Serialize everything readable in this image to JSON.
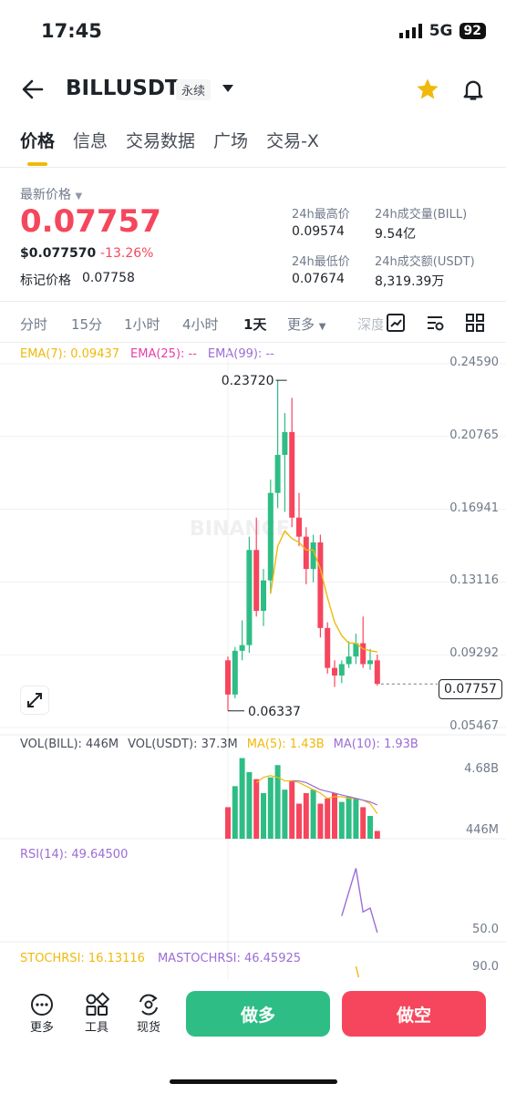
{
  "status": {
    "time": "17:45",
    "network": "5G",
    "battery": "92"
  },
  "header": {
    "pair": "BILLUSDT",
    "perp_badge": "永续"
  },
  "tabs": [
    "价格",
    "信息",
    "交易数据",
    "广场",
    "交易-X"
  ],
  "price": {
    "latest_label": "最新价格",
    "last": "0.07757",
    "usd": "$0.077570",
    "change": "-13.26%",
    "mark_label": "标记价格",
    "mark_value": "0.07758"
  },
  "stats": {
    "high_label": "24h最高价",
    "high": "0.09574",
    "vol_bill_label": "24h成交量(BILL)",
    "vol_bill": "9.54亿",
    "low_label": "24h最低价",
    "low": "0.07674",
    "vol_usdt_label": "24h成交额(USDT)",
    "vol_usdt": "8,319.39万"
  },
  "intervals": [
    "分时",
    "15分",
    "1小时",
    "4小时",
    "1天",
    "更多",
    "深度"
  ],
  "active_interval": "1天",
  "ema": {
    "ema7": "EMA(7): 0.09437",
    "ema25": "EMA(25): --",
    "ema99": "EMA(99): --"
  },
  "volume_legend": {
    "bill": "VOL(BILL): 446M",
    "usdt": "VOL(USDT): 37.3M",
    "ma5": "MA(5): 1.43B",
    "ma10": "MA(10): 1.93B"
  },
  "rsi_legend": "RSI(14): 49.64500",
  "stoch_legend": {
    "stoch": "STOCHRSI: 16.13116",
    "mastoch": "MASTOCHRSI: 46.45925"
  },
  "watermark": "BINANCE",
  "colors": {
    "up": "#2ebd85",
    "down": "#f6465d",
    "accent": "#f0b90b",
    "ema7": "#f0b90b",
    "ma10": "#9c6cd6"
  },
  "chart_data": [
    {
      "type": "candlestick",
      "y_ticks": [
        "0.24590",
        "0.20765",
        "0.16941",
        "0.13116",
        "0.09292",
        "0.05467"
      ],
      "ylim": [
        0.05467,
        0.2459
      ],
      "annotations": {
        "high": "0.23720",
        "low": "0.06337",
        "last": "0.07757"
      },
      "candles": [
        {
          "o": 0.09,
          "h": 0.092,
          "l": 0.0634,
          "c": 0.072
        },
        {
          "o": 0.072,
          "h": 0.097,
          "l": 0.07,
          "c": 0.095
        },
        {
          "o": 0.095,
          "h": 0.111,
          "l": 0.09,
          "c": 0.098
        },
        {
          "o": 0.098,
          "h": 0.155,
          "l": 0.094,
          "c": 0.148
        },
        {
          "o": 0.148,
          "h": 0.165,
          "l": 0.113,
          "c": 0.116
        },
        {
          "o": 0.116,
          "h": 0.138,
          "l": 0.108,
          "c": 0.132
        },
        {
          "o": 0.132,
          "h": 0.185,
          "l": 0.125,
          "c": 0.178
        },
        {
          "o": 0.178,
          "h": 0.2372,
          "l": 0.17,
          "c": 0.198
        },
        {
          "o": 0.198,
          "h": 0.22,
          "l": 0.168,
          "c": 0.21
        },
        {
          "o": 0.21,
          "h": 0.228,
          "l": 0.16,
          "c": 0.165
        },
        {
          "o": 0.165,
          "h": 0.178,
          "l": 0.15,
          "c": 0.155
        },
        {
          "o": 0.155,
          "h": 0.16,
          "l": 0.13,
          "c": 0.138
        },
        {
          "o": 0.138,
          "h": 0.156,
          "l": 0.131,
          "c": 0.152
        },
        {
          "o": 0.152,
          "h": 0.156,
          "l": 0.102,
          "c": 0.107
        },
        {
          "o": 0.107,
          "h": 0.11,
          "l": 0.083,
          "c": 0.086
        },
        {
          "o": 0.086,
          "h": 0.09,
          "l": 0.076,
          "c": 0.082
        },
        {
          "o": 0.082,
          "h": 0.09,
          "l": 0.078,
          "c": 0.088
        },
        {
          "o": 0.088,
          "h": 0.1,
          "l": 0.086,
          "c": 0.092
        },
        {
          "o": 0.092,
          "h": 0.104,
          "l": 0.088,
          "c": 0.099
        },
        {
          "o": 0.099,
          "h": 0.113,
          "l": 0.086,
          "c": 0.088
        },
        {
          "o": 0.088,
          "h": 0.096,
          "l": 0.085,
          "c": 0.09
        },
        {
          "o": 0.09,
          "h": 0.093,
          "l": 0.0767,
          "c": 0.0776
        }
      ],
      "ema7": [
        null,
        null,
        null,
        null,
        null,
        null,
        0.125,
        0.15,
        0.158,
        0.154,
        0.152,
        0.148,
        0.148,
        0.138,
        0.123,
        0.11,
        0.103,
        0.099,
        0.099,
        0.096,
        0.095,
        0.0944
      ]
    },
    {
      "type": "bar",
      "y_ticks": [
        "4.68B",
        "446M"
      ],
      "values": [
        1.8,
        3.0,
        4.6,
        3.8,
        3.4,
        2.6,
        3.5,
        4.2,
        2.8,
        3.3,
        2.0,
        2.6,
        2.8,
        2.0,
        2.3,
        2.6,
        2.1,
        2.4,
        2.3,
        1.8,
        1.3,
        0.446
      ],
      "ma5": [
        null,
        null,
        null,
        null,
        3.2,
        3.5,
        3.6,
        3.5,
        3.3,
        3.3,
        3.2,
        3.0,
        2.8,
        2.6,
        2.3,
        2.4,
        2.4,
        2.3,
        2.3,
        2.2,
        2.0,
        1.43
      ],
      "ma10": [
        null,
        null,
        null,
        null,
        null,
        null,
        null,
        null,
        null,
        3.3,
        3.3,
        3.2,
        3.0,
        2.8,
        2.7,
        2.6,
        2.5,
        2.4,
        2.3,
        2.2,
        2.1,
        1.93
      ]
    },
    {
      "type": "line",
      "y_ticks": [
        "50.0"
      ],
      "values": [
        null,
        null,
        null,
        null,
        null,
        null,
        null,
        null,
        null,
        null,
        null,
        null,
        null,
        null,
        null,
        null,
        58,
        70,
        82,
        60,
        62,
        49.645
      ]
    },
    {
      "type": "line",
      "y_ticks": [
        "90.0"
      ]
    }
  ],
  "bottom": {
    "more": "更多",
    "tools": "工具",
    "spot": "现货",
    "long": "做多",
    "short": "做空"
  }
}
